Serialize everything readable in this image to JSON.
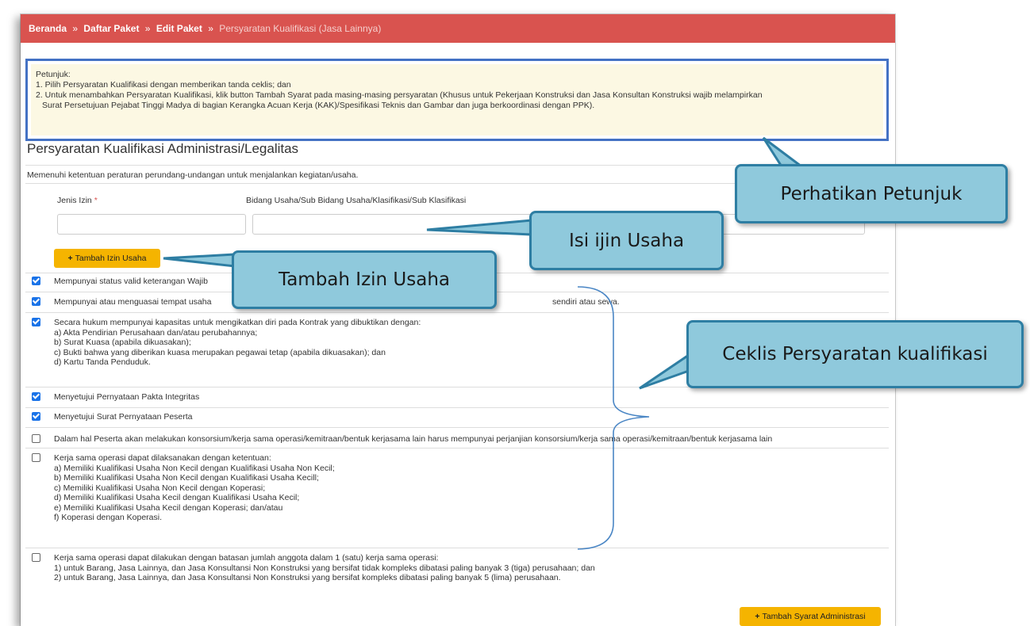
{
  "breadcrumb": {
    "home": "Beranda",
    "sep": "»",
    "list": "Daftar Paket",
    "edit": "Edit Paket",
    "current": "Persyaratan Kualifikasi (Jasa Lainnya)"
  },
  "hint": {
    "title": "Petunjuk:",
    "line1": "1. Pilih Persyaratan Kualifikasi dengan memberikan tanda ceklis; dan",
    "line2": "2. Untuk menambahkan Persyaratan Kualifikasi, klik button Tambah Syarat pada masing-masing persyaratan (Khusus untuk Pekerjaan Konstruksi dan Jasa Konsultan Konstruksi wajib melampirkan",
    "line3": "Surat Persetujuan Pejabat Tinggi Madya di bagian Kerangka Acuan Kerja (KAK)/Spesifikasi Teknis dan Gambar dan juga berkoordinasi dengan PPK)."
  },
  "section": {
    "title": "Persyaratan Kualifikasi Administrasi/Legalitas",
    "subtitle": "Memenuhi ketentuan peraturan perundang-undangan untuk menjalankan kegiatan/usaha.",
    "col_jenis": "Jenis Izin",
    "required_mark": "*",
    "col_bidang": "Bidang Usaha/Sub Bidang Usaha/Klasifikasi/Sub Klasifikasi",
    "jenis_value": "",
    "bidang_value": "",
    "add_izin": "Tambah Izin Usaha",
    "add_syarat": "Tambah Syarat Administrasi"
  },
  "items": [
    {
      "checked": true,
      "lines": [
        "Mempunyai status valid keterangan Wajib"
      ]
    },
    {
      "checked": true,
      "lines": [
        "Mempunyai atau menguasai tempat usaha",
        "sendiri atau sewa."
      ]
    },
    {
      "checked": true,
      "lines": [
        "Secara hukum mempunyai kapasitas untuk mengikatkan diri pada Kontrak yang dibuktikan dengan:",
        "a) Akta Pendirian Perusahaan dan/atau perubahannya;",
        "b) Surat Kuasa (apabila dikuasakan);",
        "c) Bukti bahwa yang diberikan kuasa merupakan pegawai tetap (apabila dikuasakan); dan",
        "d) Kartu Tanda Penduduk."
      ]
    },
    {
      "checked": true,
      "lines": [
        "Menyetujui Pernyataan Pakta Integritas"
      ]
    },
    {
      "checked": true,
      "lines": [
        "Menyetujui Surat Pernyataan Peserta"
      ]
    },
    {
      "checked": false,
      "lines": [
        "Dalam hal Peserta akan melakukan konsorsium/kerja sama operasi/kemitraan/bentuk kerjasama lain harus mempunyai perjanjian konsorsium/kerja sama operasi/kemitraan/bentuk kerjasama lain"
      ]
    },
    {
      "checked": false,
      "lines": [
        "Kerja sama operasi dapat dilaksanakan dengan ketentuan:",
        "a) Memiliki Kualifikasi Usaha Non Kecil dengan Kualifikasi Usaha Non Kecil;",
        "b) Memiliki Kualifikasi Usaha Non Kecil dengan Kualifikasi Usaha Kecill;",
        "c) Memiliki Kualifikasi Usaha Non Kecil dengan Koperasi;",
        "d) Memiliki Kualifikasi Usaha Kecil dengan Kualifikasi Usaha Kecil;",
        "e) Memiliki Kualifikasi Usaha Kecil dengan Koperasi; dan/atau",
        "f) Koperasi dengan Koperasi."
      ]
    },
    {
      "checked": false,
      "lines": [
        "Kerja sama operasi dapat dilakukan dengan batasan jumlah anggota dalam 1 (satu) kerja sama operasi:",
        "1) untuk Barang, Jasa Lainnya, dan Jasa Konsultansi Non Konstruksi yang bersifat tidak kompleks dibatasi paling banyak 3 (tiga) perusahaan; dan",
        "2) untuk Barang, Jasa Lainnya, dan Jasa Konsultansi Non Konstruksi yang bersifat kompleks dibatasi paling banyak 5 (lima) perusahaan."
      ]
    }
  ],
  "callouts": {
    "petunjuk": "Perhatikan Petunjuk",
    "isi": "Isi ijin Usaha",
    "tambah": "Tambah Izin Usaha",
    "ceklis": "Ceklis Persyaratan kualifikasi"
  },
  "colors": {
    "breadcrumb_bg": "#d9534f",
    "hint_bg": "#fcf8e3",
    "button_warning": "#f5b400",
    "checkbox": "#1a73e8",
    "callout_fill": "#8fc9dc",
    "callout_border": "#2e7ea3",
    "highlight_border": "#4472c4"
  }
}
